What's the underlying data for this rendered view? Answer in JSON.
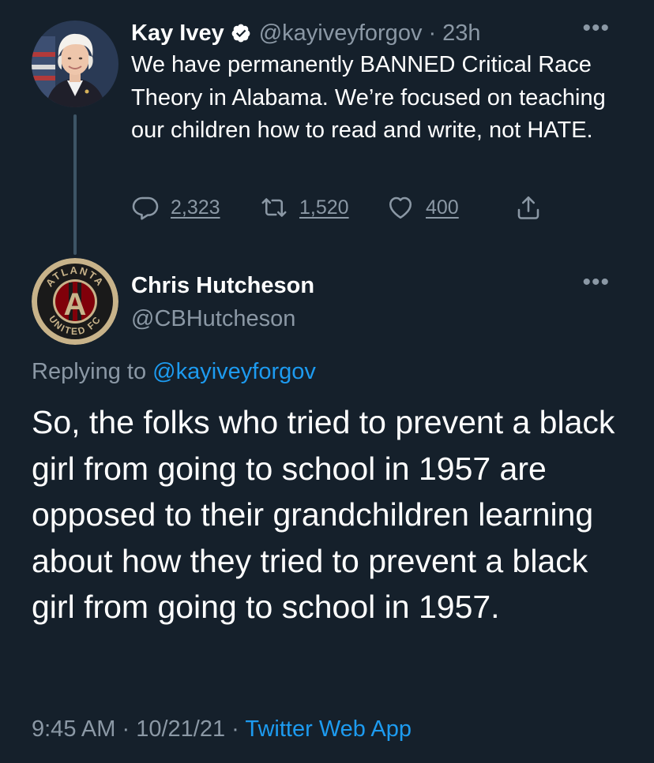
{
  "parent_tweet": {
    "display_name": "Kay Ivey",
    "handle": "@kayiveyforgov",
    "separator": "·",
    "time": "23h",
    "text": "We have permanently BANNED Critical Race Theory in Alabama. We’re focused on teaching our children how to read and write, not HATE.",
    "more_label": "•••",
    "icons": {
      "verified": "verified-badge-icon",
      "reply": "reply-icon",
      "retweet": "retweet-icon",
      "like": "like-icon",
      "share": "share-icon"
    },
    "replies": "2,323",
    "retweets": "1,520",
    "likes": "400"
  },
  "reply_tweet": {
    "display_name": "Chris Hutcheson",
    "handle": "@CBHutcheson",
    "more_label": "•••",
    "replying_prefix": "Replying to",
    "replying_to": "@kayiveyforgov",
    "text": "So, the folks who tried to prevent a black girl from going to school in 1957 are opposed to their grandchildren learning about how they tried to prevent a black girl from going to school in 1957.",
    "time": "9:45 AM",
    "separator_1": "·",
    "date": "10/21/21",
    "separator_2": "·",
    "source": "Twitter Web App",
    "avatar_logo": {
      "top_text": "ATLANTA",
      "bottom_text": "UNITED FC",
      "letter": "A"
    }
  },
  "colors": {
    "background": "#15202b",
    "text_primary": "#ffffff",
    "text_secondary": "#8b98a5",
    "accent": "#1d9bf0",
    "thread_line": "#3d5466"
  }
}
